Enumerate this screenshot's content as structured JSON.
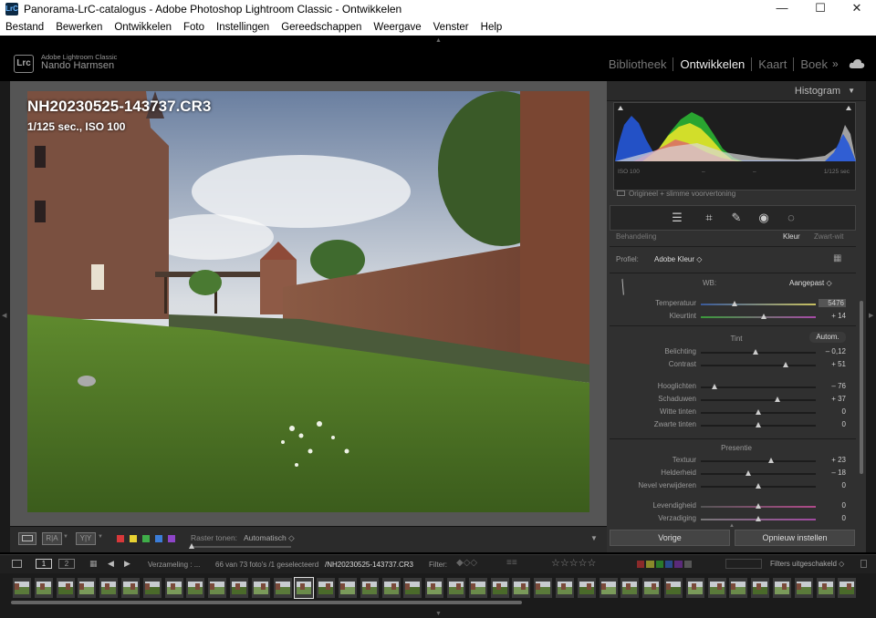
{
  "window": {
    "title": "Panorama-LrC-catalogus - Adobe Photoshop Lightroom Classic - Ontwikkelen",
    "app_badge": "LrC",
    "minimize": "—",
    "maximize": "☐",
    "close": "✕"
  },
  "menu": [
    "Bestand",
    "Bewerken",
    "Ontwikkelen",
    "Foto",
    "Instellingen",
    "Gereedschappen",
    "Weergave",
    "Venster",
    "Help"
  ],
  "identity": {
    "logo": "Lrc",
    "product": "Adobe Lightroom Classic",
    "user": "Nando Harmsen"
  },
  "modules": {
    "library": "Bibliotheek",
    "develop": "Ontwikkelen",
    "map": "Kaart",
    "book": "Boek"
  },
  "photo": {
    "filename": "NH20230525-143737.CR3",
    "exposure_info": "1/125 sec., ISO 100"
  },
  "toolbar": {
    "view_before_after": "R|A",
    "view_yy": "Y|Y",
    "grid_label": "Raster tonen:",
    "grid_value": "Automatisch ◇",
    "color_labels": [
      "#d8383a",
      "#e8d232",
      "#3fae49",
      "#3b7dd8",
      "#8e45c8"
    ]
  },
  "panel": {
    "histogram_title": "Histogram",
    "iso": "ISO 100",
    "dash1": "–",
    "dash2": "–",
    "shutter": "1/125 sec",
    "preview": "Origineel + slimme voorvertoning",
    "treatment_label": "Behandeling",
    "treatment_color": "Kleur",
    "treatment_bw": "Zwart-wit",
    "profile_label": "Profiel:",
    "profile_value": "Adobe Kleur ◇",
    "wb_label": "WB:",
    "wb_value": "Aangepast ◇",
    "basic": [
      {
        "label": "Temperatuur",
        "value": "5476",
        "pos": 0.29
      },
      {
        "label": "Kleurtint",
        "value": "+ 14",
        "pos": 0.55
      }
    ],
    "tone_title": "Tint",
    "auto_label": "Autom.",
    "tone": [
      {
        "label": "Belichting",
        "value": "– 0,12",
        "pos": 0.48
      },
      {
        "label": "Contrast",
        "value": "+ 51",
        "pos": 0.74
      }
    ],
    "tone2": [
      {
        "label": "Hooglichten",
        "value": "– 76",
        "pos": 0.12
      },
      {
        "label": "Schaduwen",
        "value": "+ 37",
        "pos": 0.67
      },
      {
        "label": "Witte tinten",
        "value": "0",
        "pos": 0.5
      },
      {
        "label": "Zwarte tinten",
        "value": "0",
        "pos": 0.5
      }
    ],
    "presence_title": "Presentie",
    "presence": [
      {
        "label": "Textuur",
        "value": "+ 23",
        "pos": 0.61
      },
      {
        "label": "Helderheid",
        "value": "– 18",
        "pos": 0.41
      },
      {
        "label": "Nevel verwijderen",
        "value": "0",
        "pos": 0.5
      }
    ],
    "presence2": [
      {
        "label": "Levendigheid",
        "value": "0",
        "pos": 0.5
      },
      {
        "label": "Verzadiging",
        "value": "0",
        "pos": 0.5
      }
    ],
    "btn_previous": "Vorige",
    "btn_reset": "Opnieuw instellen"
  },
  "filmstrip": {
    "view1": "1",
    "view2": "2",
    "source": "Verzameling : ...",
    "count": "66 van 73 foto's /1 geselecteerd",
    "current": "/NH20230525-143737.CR3",
    "filter_label": "Filter:",
    "stars": "☆☆☆☆☆",
    "filter_off": "Filters uitgeschakeld ◇"
  }
}
